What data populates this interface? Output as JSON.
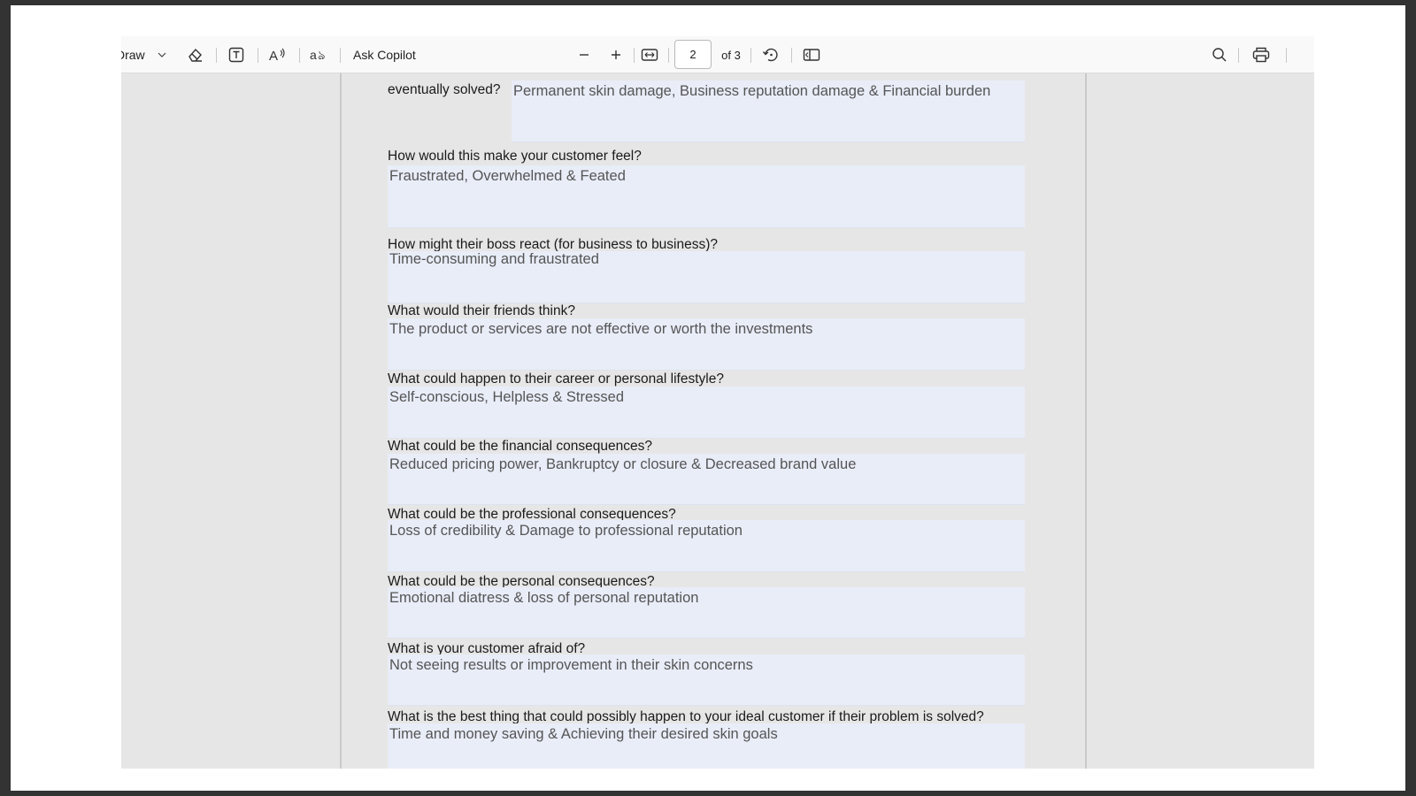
{
  "toolbar": {
    "draw_label": "Draw",
    "ask_copilot_label": "Ask Copilot",
    "page_number": "2",
    "page_total": "of 3",
    "icons": [
      "chevron-down-icon",
      "eraser-icon",
      "text-box-icon",
      "read-aloud-icon",
      "translate-icon",
      "zoom-out-icon",
      "zoom-in-icon",
      "fit-width-icon",
      "rotate-icon",
      "page-view-icon",
      "search-icon",
      "print-icon"
    ]
  },
  "document": {
    "first_question": "eventually solved?",
    "first_answer": "Permanent skin damage, Business reputation damage & Financial burden",
    "items": [
      {
        "question": "How would this make your customer feel?",
        "answer": "Fraustrated, Overwhelmed & Feated"
      },
      {
        "question": "How might their boss react (for business to business)?",
        "answer": "Time-consuming and fraustrated"
      },
      {
        "question": "What would their friends think?",
        "answer": "The product or services are not effective or worth the investments"
      },
      {
        "question": "What could happen to their career or personal lifestyle?",
        "answer": "Self-conscious, Helpless & Stressed"
      },
      {
        "question": "What could be the financial consequences?",
        "answer": "Reduced pricing power, Bankruptcy or closure & Decreased brand value"
      },
      {
        "question": "What could be the professional consequences?",
        "answer": "Loss of credibility & Damage to professional reputation"
      },
      {
        "question": "What could be the personal consequences?",
        "answer": "Emotional diatress & loss of personal reputation"
      },
      {
        "question": "What is your customer afraid of?",
        "answer": "Not seeing results or improvement in their skin concerns"
      },
      {
        "question": "What is the best thing that could possibly happen to your ideal customer if their problem is solved?",
        "answer": "Time and money saving & Achieving their desired skin goals"
      }
    ]
  },
  "colors": {
    "toolbar_bg": "#f9f9f9",
    "viewer_bg": "#e6e6e6",
    "field_bg": "#e9edf8",
    "answer_text": "#555555"
  }
}
